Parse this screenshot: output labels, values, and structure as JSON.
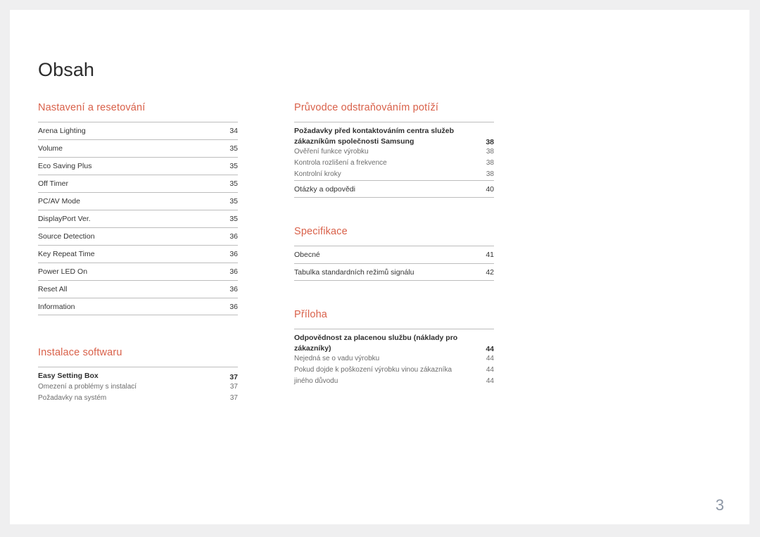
{
  "document": {
    "title": "Obsah",
    "page_number": "3",
    "accent_color": "#d9614a",
    "page_number_color": "#8d97a5",
    "background_color": "#efeff0",
    "page_color": "#ffffff"
  },
  "columns": {
    "left": [
      {
        "heading": "Nastavení a resetování",
        "entries": [
          {
            "type": "primary",
            "label": "Arena Lighting",
            "page": "34"
          },
          {
            "type": "primary",
            "label": "Volume",
            "page": "35"
          },
          {
            "type": "primary",
            "label": "Eco Saving Plus",
            "page": "35"
          },
          {
            "type": "primary",
            "label": "Off Timer",
            "page": "35"
          },
          {
            "type": "primary",
            "label": "PC/AV Mode",
            "page": "35"
          },
          {
            "type": "primary",
            "label": "DisplayPort Ver.",
            "page": "35"
          },
          {
            "type": "primary",
            "label": "Source Detection",
            "page": "36"
          },
          {
            "type": "primary",
            "label": "Key Repeat Time",
            "page": "36"
          },
          {
            "type": "primary",
            "label": "Power LED On",
            "page": "36"
          },
          {
            "type": "primary",
            "label": "Reset All",
            "page": "36"
          },
          {
            "type": "primary",
            "label": "Information",
            "page": "36",
            "last": true
          }
        ]
      },
      {
        "heading": "Instalace softwaru",
        "entries": [
          {
            "type": "group",
            "closed": false,
            "head": {
              "label": "Easy Setting Box",
              "page": "37"
            },
            "subs": [
              {
                "label": "Omezení a problémy s instalací",
                "page": "37"
              },
              {
                "label": "Požadavky na systém",
                "page": "37"
              }
            ]
          }
        ]
      }
    ],
    "right": [
      {
        "heading": "Průvodce odstraňováním potíží",
        "entries": [
          {
            "type": "group",
            "closed": false,
            "head": {
              "label": "Požadavky před kontaktováním centra služeb zákazníkům společnosti Samsung",
              "page": "38"
            },
            "subs": [
              {
                "label": "Ověření funkce výrobku",
                "page": "38"
              },
              {
                "label": "Kontrola rozlišení a frekvence",
                "page": "38"
              },
              {
                "label": "Kontrolní kroky",
                "page": "38"
              }
            ]
          },
          {
            "type": "primary",
            "label": "Otázky a odpovědi",
            "page": "40",
            "last": true
          }
        ]
      },
      {
        "heading": "Specifikace",
        "entries": [
          {
            "type": "primary",
            "label": "Obecné",
            "page": "41"
          },
          {
            "type": "primary",
            "label": "Tabulka standardních režimů signálu",
            "page": "42",
            "last": true
          }
        ]
      },
      {
        "heading": "Příloha",
        "entries": [
          {
            "type": "group",
            "closed": false,
            "head": {
              "label": "Odpovědnost za placenou službu (náklady pro zákazníky)",
              "page": "44"
            },
            "subs": [
              {
                "label": "Nejedná se o vadu výrobku",
                "page": "44"
              },
              {
                "label": "Pokud dojde k poškození výrobku vinou zákazníka",
                "page": "44"
              },
              {
                "label": "jiného důvodu",
                "page": "44"
              }
            ]
          }
        ]
      }
    ]
  }
}
